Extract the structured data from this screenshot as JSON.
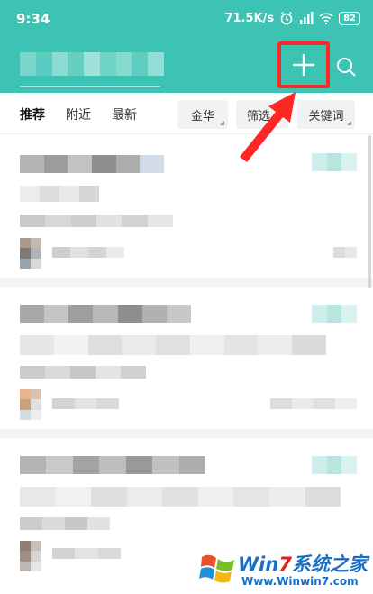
{
  "status_bar": {
    "time": "9:34",
    "network_speed": "71.5K/s",
    "battery": "82",
    "icons": [
      "alarm-icon",
      "hd-signal-icon",
      "wifi-icon",
      "battery-icon"
    ]
  },
  "header": {
    "add_icon": "plus-icon",
    "search_icon": "search-icon",
    "accent_color": "#3cc3b3",
    "highlight_color": "#ff2626"
  },
  "tabs": [
    {
      "label": "推荐",
      "active": true
    },
    {
      "label": "附近",
      "active": false
    },
    {
      "label": "最新",
      "active": false
    }
  ],
  "filters": [
    {
      "label": "金华"
    },
    {
      "label": "筛选"
    },
    {
      "label": "关键词"
    }
  ],
  "watermark": {
    "brand_prefix": "Win",
    "brand_number": "7",
    "brand_suffix": "系统之家",
    "url": "Www.Winwin7.com"
  }
}
